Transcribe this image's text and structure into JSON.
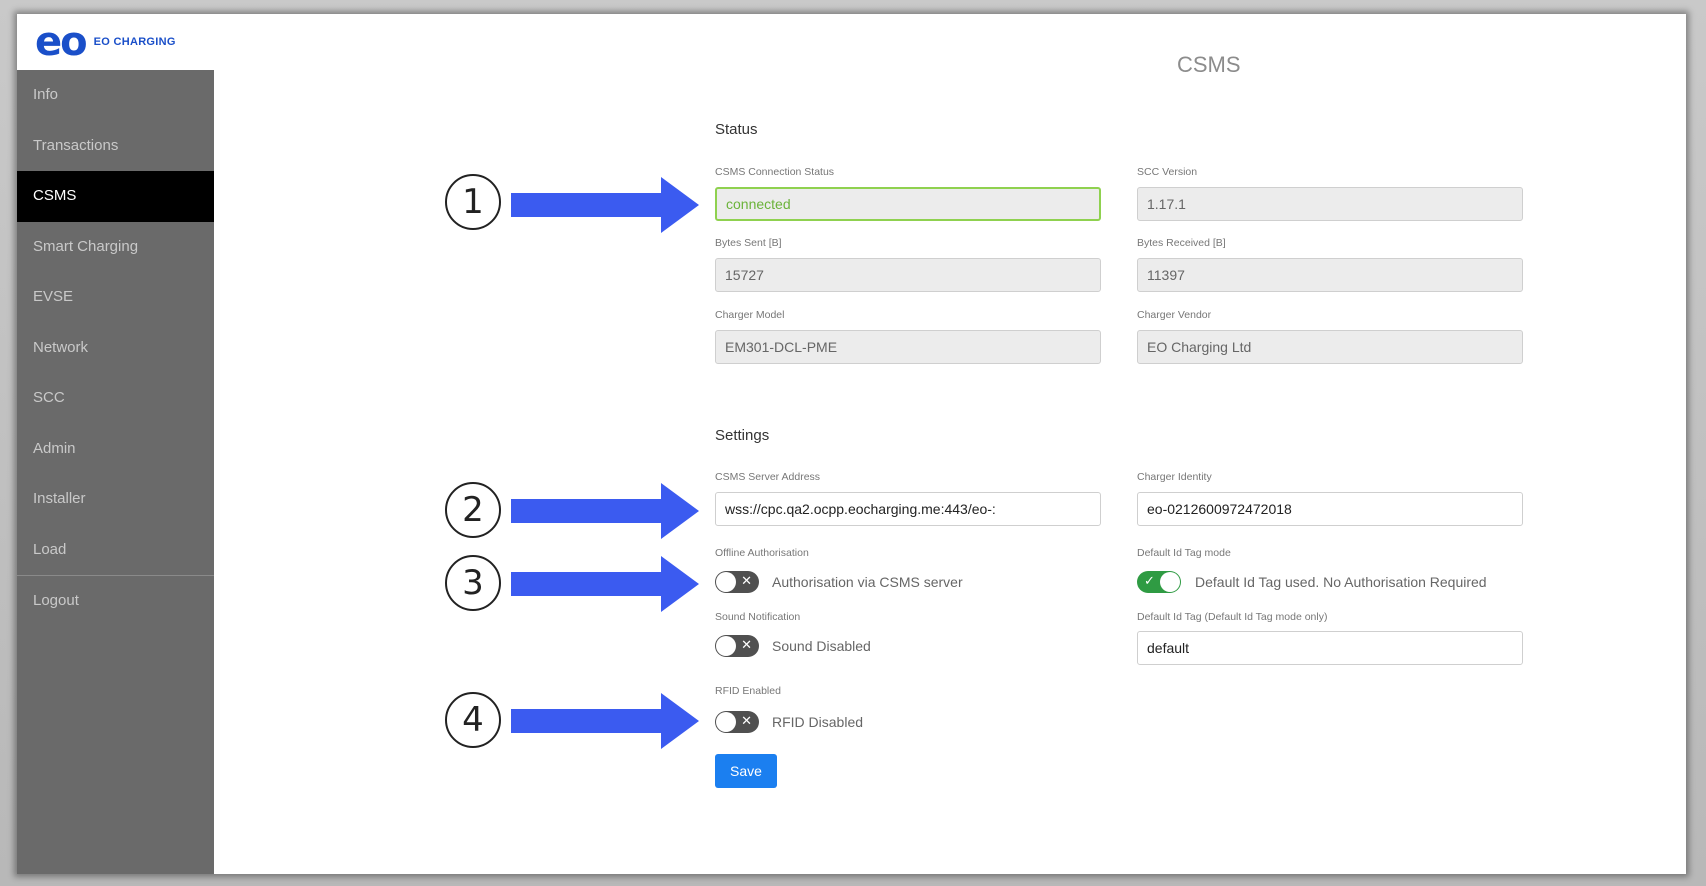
{
  "brand": {
    "logo": "eo",
    "name": "EO CHARGING"
  },
  "nav": {
    "items": [
      "Info",
      "Transactions",
      "CSMS",
      "Smart Charging",
      "EVSE",
      "Network",
      "SCC",
      "Admin",
      "Installer",
      "Load"
    ],
    "active": "CSMS",
    "logout": "Logout"
  },
  "page": {
    "title": "CSMS"
  },
  "status": {
    "heading": "Status",
    "connection_label": "CSMS Connection Status",
    "connection_value": "connected",
    "scc_label": "SCC Version",
    "scc_value": "1.17.1",
    "sent_label": "Bytes Sent [B]",
    "sent_value": "15727",
    "received_label": "Bytes Received [B]",
    "received_value": "11397",
    "model_label": "Charger Model",
    "model_value": "EM301-DCL-PME",
    "vendor_label": "Charger Vendor",
    "vendor_value": "EO Charging Ltd"
  },
  "settings": {
    "heading": "Settings",
    "server_label": "CSMS Server Address",
    "server_value": "wss://cpc.qa2.ocpp.eocharging.me:443/eo-:",
    "identity_label": "Charger Identity",
    "identity_value": "eo-0212600972472018",
    "offline_label": "Offline Authorisation",
    "offline_text": "Authorisation via CSMS server",
    "offline_on": false,
    "default_mode_label": "Default Id Tag mode",
    "default_mode_text": "Default Id Tag used. No Authorisation Required",
    "default_mode_on": true,
    "sound_label": "Sound Notification",
    "sound_text": "Sound Disabled",
    "sound_on": false,
    "default_tag_label": "Default Id Tag (Default Id Tag mode only)",
    "default_tag_value": "default",
    "rfid_label": "RFID Enabled",
    "rfid_text": "RFID Disabled",
    "rfid_on": false,
    "save_label": "Save"
  },
  "annotations": {
    "labels": [
      "1",
      "2",
      "3",
      "4"
    ],
    "arrow_color": "#3b5bf0"
  },
  "colors": {
    "sidebar": "#6a6a6a",
    "active_nav": "#000000",
    "accent": "#1b7ff0",
    "connected": "#8fd14f",
    "toggle_on": "#2f9b43"
  }
}
